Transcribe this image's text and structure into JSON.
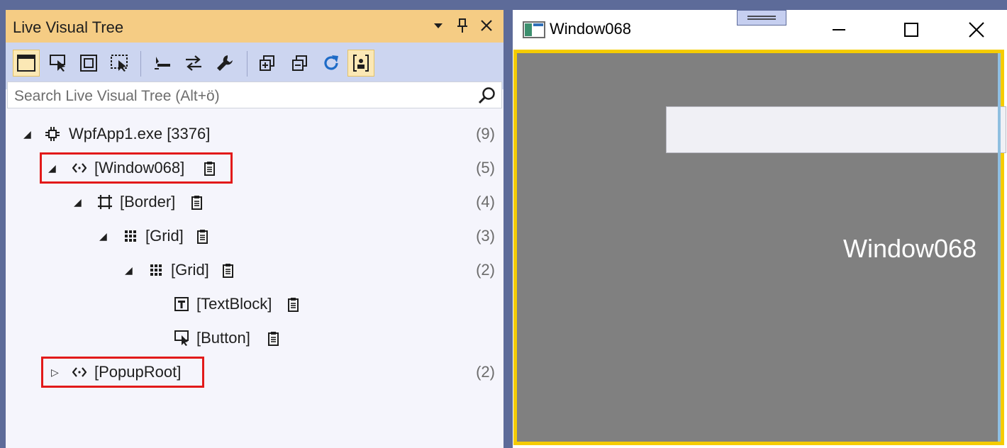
{
  "panel": {
    "title": "Live Visual Tree",
    "search_placeholder": "Search Live Visual Tree (Alt+ö)",
    "toolbar": [
      {
        "icon": "window-icon",
        "active": true
      },
      {
        "icon": "select-element-icon",
        "active": false
      },
      {
        "icon": "layout-adorner-icon",
        "active": false
      },
      {
        "icon": "track-focus-icon",
        "active": false
      },
      {
        "icon": "show-just-my-xaml-icon",
        "active": false
      },
      {
        "icon": "swap-icon",
        "active": false
      },
      {
        "icon": "wrench-icon",
        "active": false
      },
      {
        "icon": "expand-all-icon",
        "active": false
      },
      {
        "icon": "collapse-all-icon",
        "active": false
      },
      {
        "icon": "refresh-icon",
        "active": false
      },
      {
        "icon": "show-properties-icon",
        "active": true
      }
    ]
  },
  "tree": [
    {
      "label": "WpfApp1.exe [3376]",
      "count": "(9)",
      "expanded": true,
      "icon": "process-icon",
      "has_doc": false
    },
    {
      "label": "[Window068]",
      "count": "(5)",
      "expanded": true,
      "icon": "code-brackets-icon",
      "has_doc": true
    },
    {
      "label": "[Border]",
      "count": "(4)",
      "expanded": true,
      "icon": "border-icon",
      "has_doc": true
    },
    {
      "label": "[Grid]",
      "count": "(3)",
      "expanded": true,
      "icon": "grid-icon",
      "has_doc": true
    },
    {
      "label": "[Grid]",
      "count": "(2)",
      "expanded": true,
      "icon": "grid-icon",
      "has_doc": true
    },
    {
      "label": "[TextBlock]",
      "count": "",
      "expanded": null,
      "icon": "textblock-icon",
      "has_doc": true
    },
    {
      "label": "[Button]",
      "count": "",
      "expanded": null,
      "icon": "button-icon",
      "has_doc": true
    },
    {
      "label": "[PopupRoot]",
      "count": "(2)",
      "expanded": false,
      "icon": "code-brackets-icon",
      "has_doc": false
    }
  ],
  "window": {
    "title": "Window068",
    "content_text": "Window068"
  },
  "colors": {
    "title_bar": "#f5cc84",
    "toolbar": "#ccd5f0",
    "highlight": "#e21a1a",
    "window_border": "#f5cc00",
    "window_client": "#808080"
  }
}
